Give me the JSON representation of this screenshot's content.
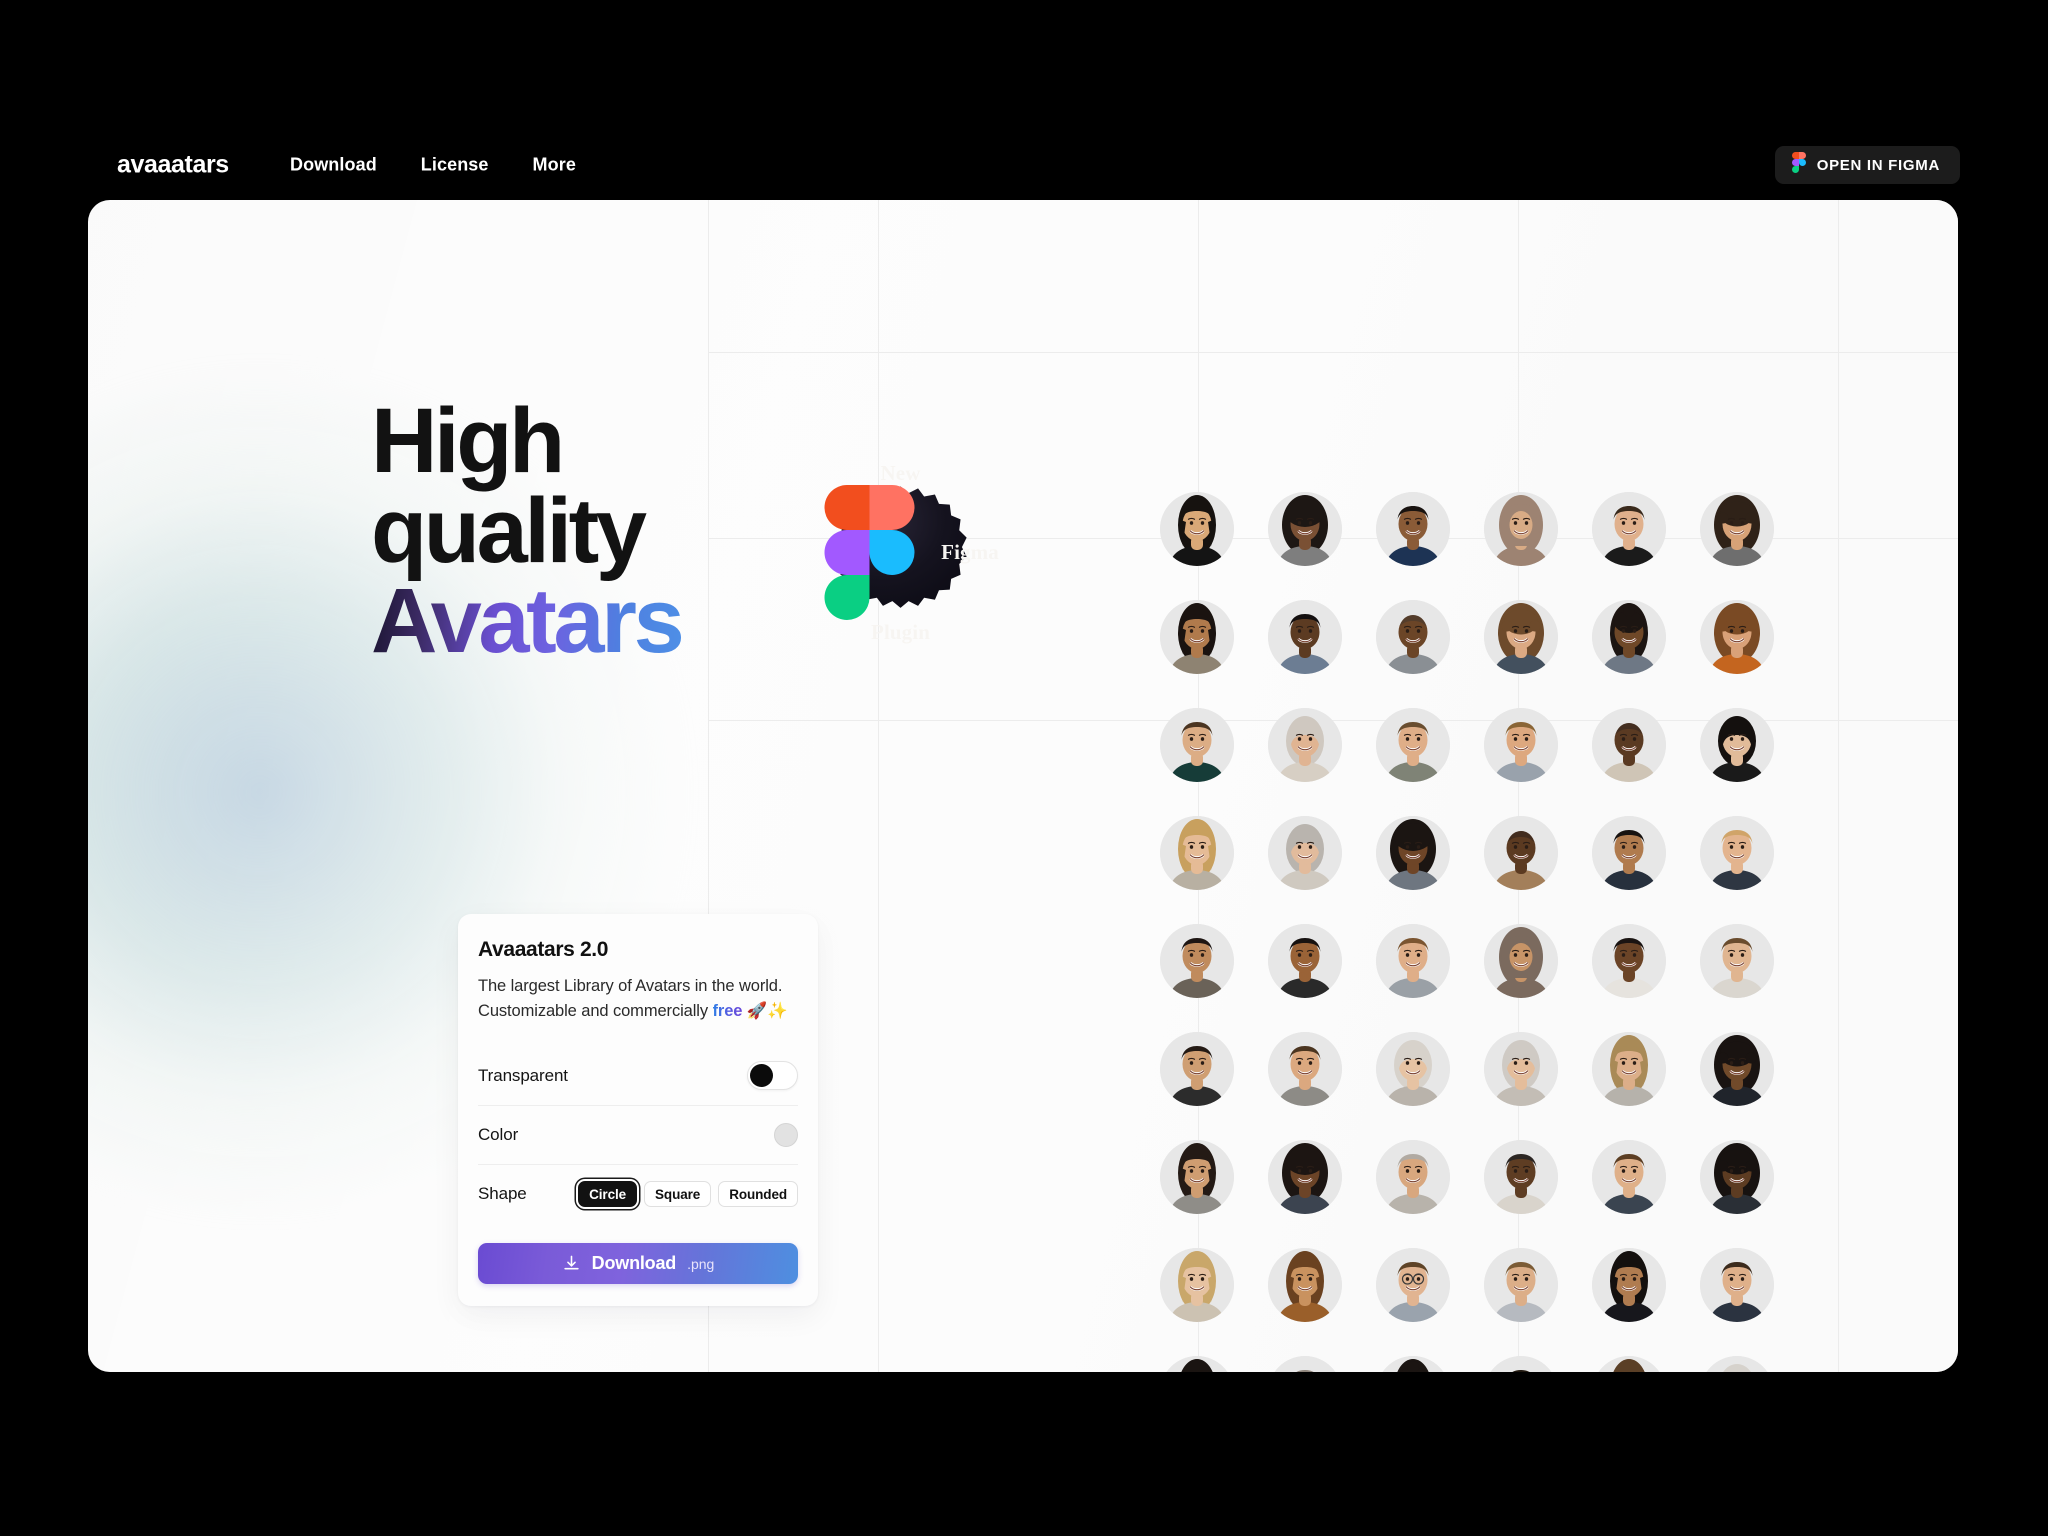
{
  "header": {
    "brand": "avaaatars",
    "nav": [
      {
        "label": "Download"
      },
      {
        "label": "License"
      },
      {
        "label": "More"
      }
    ],
    "figma_button": {
      "label": "OPEN IN FIGMA",
      "icon": "figma-icon"
    }
  },
  "hero": {
    "line1": "High",
    "line2": "quality",
    "line3": "Avatars",
    "gradient_from": "#1a1430",
    "gradient_to": "#4e8fe6"
  },
  "badge": {
    "line1": "New",
    "line2": "Figma",
    "line3": "Plugin",
    "icon": "figma-icon",
    "bg": "#15131f"
  },
  "card": {
    "title": "Avaaatars 2.0",
    "description_part1": "The largest Library of Avatars in the world. Customizable and commercially ",
    "description_highlight": "free",
    "description_emoji": " 🚀✨",
    "rows": {
      "transparent": {
        "label": "Transparent",
        "control": "toggle",
        "state": "off"
      },
      "color": {
        "label": "Color",
        "control": "color-swatch",
        "value": "#e2e2e2"
      },
      "shape": {
        "label": "Shape",
        "options": [
          {
            "label": "Circle",
            "selected": true
          },
          {
            "label": "Square",
            "selected": false
          },
          {
            "label": "Rounded",
            "selected": false
          }
        ]
      }
    },
    "download": {
      "label": "Download",
      "extension": ".png",
      "icon": "download-icon",
      "gradient_from": "#6a4bd2",
      "gradient_to": "#4e8fe0"
    }
  },
  "avatar_grid": {
    "columns": 6,
    "rows": 9,
    "background": "#e7e7e7",
    "avatars": [
      {
        "skin": "#d9a877",
        "hair": "#16120f",
        "shirt": "#141414",
        "style": "long"
      },
      {
        "skin": "#7a5034",
        "hair": "#1d1714",
        "shirt": "#7e7e7e",
        "style": "afro"
      },
      {
        "skin": "#8a5b37",
        "hair": "#191310",
        "shirt": "#1d3354",
        "style": "short"
      },
      {
        "skin": "#d8ab85",
        "hair": "#9d8372",
        "shirt": "#9d8372",
        "style": "hijab"
      },
      {
        "skin": "#e0b08c",
        "hair": "#3a2a1c",
        "shirt": "#1b1b1b",
        "style": "short"
      },
      {
        "skin": "#d7a277",
        "hair": "#2f2218",
        "shirt": "#6e6e6e",
        "style": "curly"
      },
      {
        "skin": "#b07a4c",
        "hair": "#1a1310",
        "shirt": "#8e8372",
        "style": "long"
      },
      {
        "skin": "#5c3b22",
        "hair": "#141010",
        "shirt": "#6c7d93",
        "style": "short"
      },
      {
        "skin": "#6b4527",
        "hair": "#3a3330",
        "shirt": "#8a8f94",
        "style": "bald"
      },
      {
        "skin": "#dba983",
        "hair": "#6d4a2b",
        "shirt": "#43505e",
        "style": "curly"
      },
      {
        "skin": "#6f4828",
        "hair": "#1c1512",
        "shirt": "#6e7885",
        "style": "updo"
      },
      {
        "skin": "#d9a178",
        "hair": "#7a4a24",
        "shirt": "#c4651f",
        "style": "curly"
      },
      {
        "skin": "#dcad85",
        "hair": "#4b3521",
        "shirt": "#163c38",
        "style": "short"
      },
      {
        "skin": "#e0b492",
        "hair": "#cfc8c0",
        "shirt": "#d7cfc4",
        "style": "bob"
      },
      {
        "skin": "#dfae88",
        "hair": "#6a4e30",
        "shirt": "#7f8376",
        "style": "short"
      },
      {
        "skin": "#dda87f",
        "hair": "#8a6536",
        "shirt": "#99a2ac",
        "style": "short"
      },
      {
        "skin": "#5a3a22",
        "hair": "#2a2220",
        "shirt": "#cfc5b6",
        "style": "bald"
      },
      {
        "skin": "#e1bb99",
        "hair": "#14100e",
        "shirt": "#1a1a1a",
        "style": "bob"
      },
      {
        "skin": "#e5bb96",
        "hair": "#c8a05e",
        "shirt": "#b8b0a2",
        "style": "long"
      },
      {
        "skin": "#e2bb9c",
        "hair": "#b9b4ae",
        "shirt": "#cfc9c0",
        "style": "bob"
      },
      {
        "skin": "#6e4527",
        "hair": "#1b1512",
        "shirt": "#6e7680",
        "style": "afro"
      },
      {
        "skin": "#5b3a21",
        "hair": "#231d1a",
        "shirt": "#a37f5a",
        "style": "bald"
      },
      {
        "skin": "#b07b4e",
        "hair": "#171210",
        "shirt": "#27303d",
        "style": "short"
      },
      {
        "skin": "#e3b48e",
        "hair": "#d0a469",
        "shirt": "#2e3642",
        "style": "short"
      },
      {
        "skin": "#c08b5d",
        "hair": "#1e1613",
        "shirt": "#6a6258",
        "style": "short"
      },
      {
        "skin": "#9a6337",
        "hair": "#171210",
        "shirt": "#2a2a2a",
        "style": "short"
      },
      {
        "skin": "#dfae88",
        "hair": "#7b5530",
        "shirt": "#9aa0a6",
        "style": "short"
      },
      {
        "skin": "#c79467",
        "hair": "#7b6a5e",
        "shirt": "#7b6a5e",
        "style": "hijab"
      },
      {
        "skin": "#6b4427",
        "hair": "#1a1412",
        "shirt": "#e6e3de",
        "style": "short"
      },
      {
        "skin": "#e0b590",
        "hair": "#6a4c2d",
        "shirt": "#dad6cf",
        "style": "short"
      },
      {
        "skin": "#cf9e72",
        "hair": "#241a14",
        "shirt": "#2c2c2c",
        "style": "short"
      },
      {
        "skin": "#dba87f",
        "hair": "#4b3520",
        "shirt": "#8d8b86",
        "style": "short"
      },
      {
        "skin": "#e6c3a3",
        "hair": "#d7d2cb",
        "shirt": "#b9b3ab",
        "style": "bob"
      },
      {
        "skin": "#e4bd9b",
        "hair": "#cfcac4",
        "shirt": "#c3bdb5",
        "style": "bob"
      },
      {
        "skin": "#dcae89",
        "hair": "#a98a57",
        "shirt": "#b6b2ab",
        "style": "long"
      },
      {
        "skin": "#714a2a",
        "hair": "#191311",
        "shirt": "#20242b",
        "style": "curly"
      },
      {
        "skin": "#cf9d71",
        "hair": "#241a15",
        "shirt": "#8f8d88",
        "style": "long"
      },
      {
        "skin": "#6c4427",
        "hair": "#1c1512",
        "shirt": "#3c4450",
        "style": "afro"
      },
      {
        "skin": "#d8a77e",
        "hair": "#b1aaa2",
        "shirt": "#b8b3ab",
        "style": "short"
      },
      {
        "skin": "#5e3d23",
        "hair": "#2c2623",
        "shirt": "#d9d4cc",
        "style": "short"
      },
      {
        "skin": "#dfb089",
        "hair": "#5c3e23",
        "shirt": "#3a4450",
        "style": "short"
      },
      {
        "skin": "#5d3c22",
        "hair": "#171210",
        "shirt": "#2a2f36",
        "style": "curly"
      },
      {
        "skin": "#e6c2a1",
        "hair": "#c9a76a",
        "shirt": "#ccc2b2",
        "style": "long"
      },
      {
        "skin": "#c9925f",
        "hair": "#6a4120",
        "shirt": "#9a5f2a",
        "style": "long"
      },
      {
        "skin": "#e1b491",
        "hair": "#5f4427",
        "shirt": "#9aa3ad",
        "style": "glasses"
      },
      {
        "skin": "#dcae88",
        "hair": "#7c5c36",
        "shirt": "#b6bac0",
        "style": "short"
      },
      {
        "skin": "#b07c50",
        "hair": "#14100e",
        "shirt": "#17171c",
        "style": "long"
      },
      {
        "skin": "#dfb08a",
        "hair": "#3c2b1c",
        "shirt": "#2b3340",
        "style": "short"
      },
      {
        "skin": "#d6a47b",
        "hair": "#1a1411",
        "shirt": "#b2aca3",
        "style": "long"
      },
      {
        "skin": "#dcae89",
        "hair": "#8f857c",
        "shirt": "#6d7f92",
        "style": "short"
      },
      {
        "skin": "#6c4427",
        "hair": "#1b1512",
        "shirt": "#b5ada0",
        "style": "updo"
      },
      {
        "skin": "#d09a6c",
        "hair": "#20180f",
        "shirt": "#b8bcc2",
        "style": "short"
      },
      {
        "skin": "#c8956a",
        "hair": "#5a3f26",
        "shirt": "#7d7d7d",
        "style": "long"
      },
      {
        "skin": "#e7c7aa",
        "hair": "#d6d2cc",
        "shirt": "#c6c0b7",
        "style": "bob"
      }
    ]
  }
}
